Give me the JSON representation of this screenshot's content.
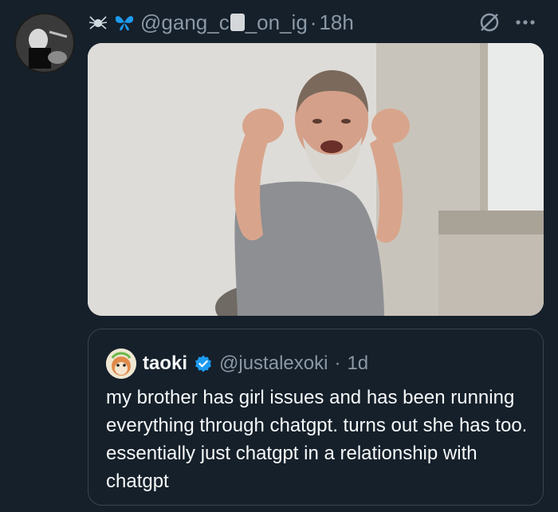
{
  "tweet": {
    "handle": "@gang_c",
    "handle_rest": "_on_ig",
    "separator": "·",
    "time": "18h"
  },
  "quote": {
    "name": "taoki",
    "handle": "@justalexoki",
    "separator": "·",
    "time": "1d",
    "text": "my brother has girl issues and has been running everything through chatgpt. turns out she has too. essentially just chatgpt in a relationship with chatgpt"
  },
  "colors": {
    "background": "#15202b",
    "secondary_text": "#8b98a5",
    "verified": "#1d9bf0",
    "border": "#38444d"
  },
  "icons": [
    "spider-icon",
    "butterfly-icon",
    "grok-icon",
    "more-icon",
    "verified-badge-icon"
  ]
}
